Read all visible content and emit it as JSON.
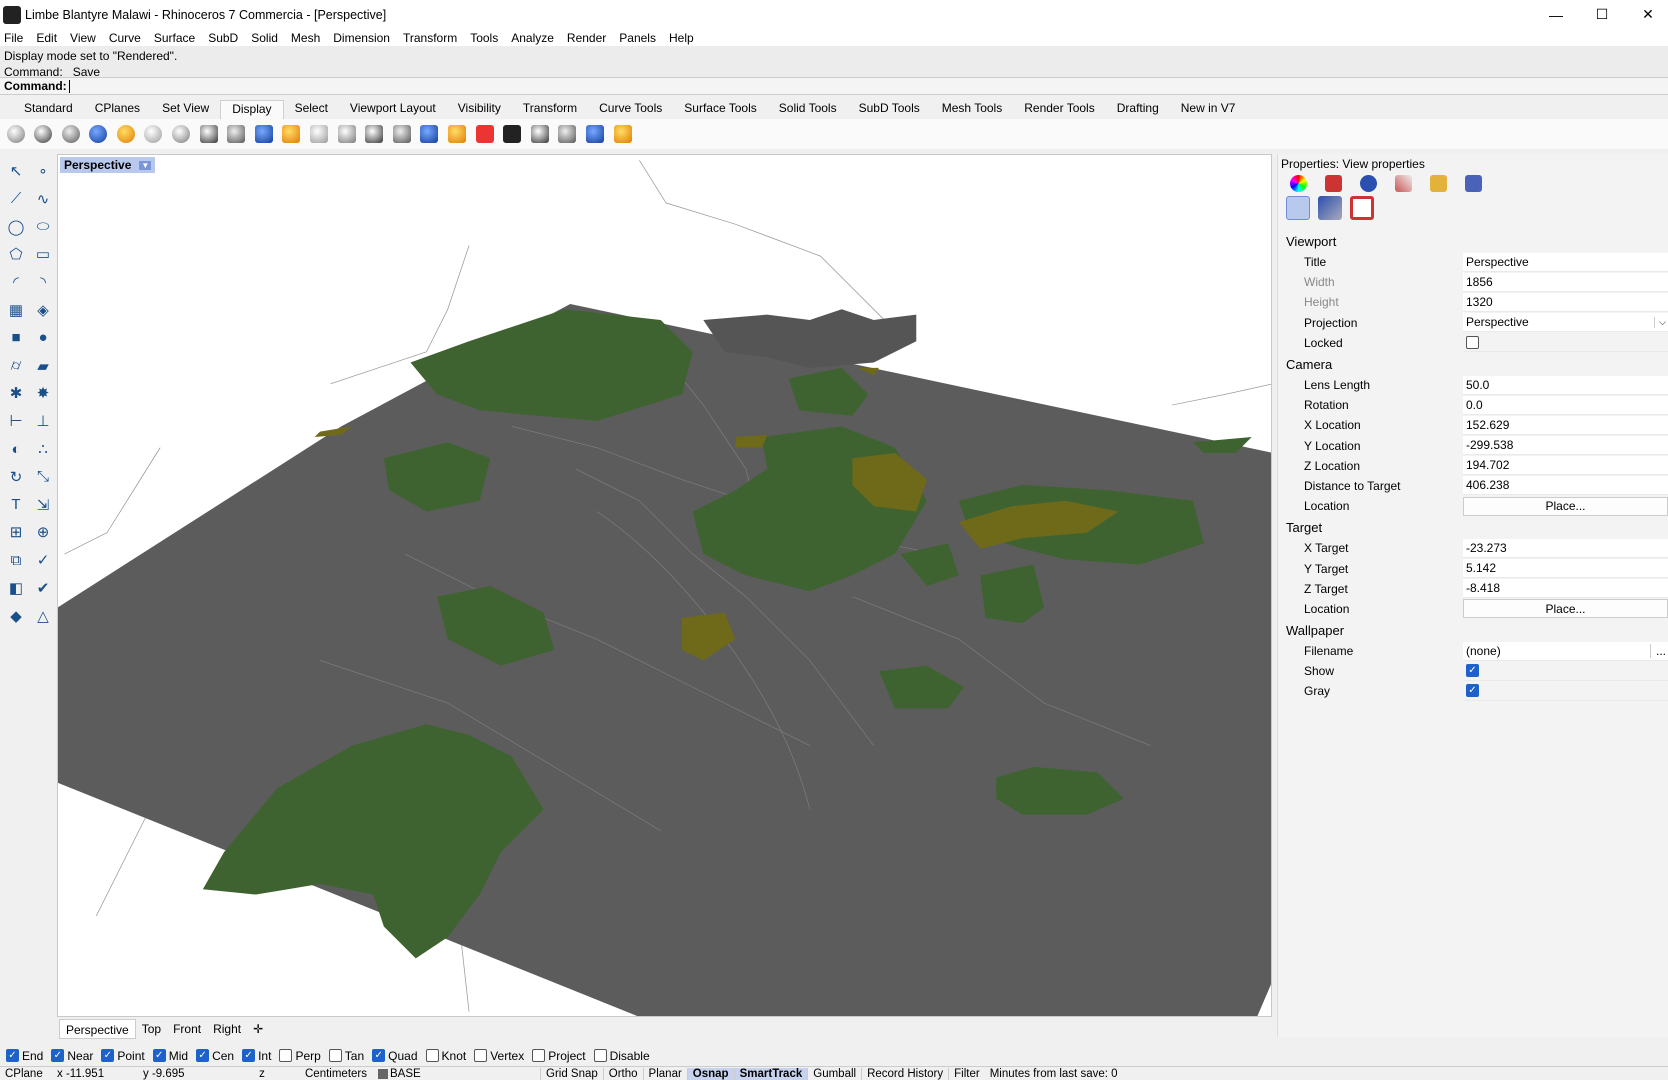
{
  "window": {
    "title": "Limbe Blantyre Malawi - Rhinoceros 7 Commercia - [Perspective]",
    "minimize": "—",
    "maximize": "☐",
    "close": "✕"
  },
  "menu": [
    "File",
    "Edit",
    "View",
    "Curve",
    "Surface",
    "SubD",
    "Solid",
    "Mesh",
    "Dimension",
    "Transform",
    "Tools",
    "Analyze",
    "Render",
    "Panels",
    "Help"
  ],
  "command": {
    "history": [
      "Display mode set to \"Rendered\".",
      "Command: _Save"
    ],
    "prompt": "Command:"
  },
  "toolbar_tabs": [
    "Standard",
    "CPlanes",
    "Set View",
    "Display",
    "Select",
    "Viewport Layout",
    "Visibility",
    "Transform",
    "Curve Tools",
    "Surface Tools",
    "Solid Tools",
    "SubD Tools",
    "Mesh Tools",
    "Render Tools",
    "Drafting",
    "New in V7"
  ],
  "active_tab": "Display",
  "toolbar_icons": [
    "wireframe",
    "shaded",
    "rendered",
    "ghosted",
    "xray",
    "technical",
    "artistic",
    "pen",
    "arctic",
    "monochrome",
    "hidden",
    "clipping-plane",
    "environment",
    "ground-plane",
    "lighting",
    "zebra",
    "curvature",
    "draft-angle",
    "show-object",
    "disable-viewport",
    "screen-capture",
    "section-tools",
    "display-options"
  ],
  "viewport": {
    "label": "Perspective",
    "colors": {
      "ground": "#5c5c5c",
      "forest": "#3f6330",
      "olive": "#6e6a1a"
    }
  },
  "viewport_tabs": [
    "Perspective",
    "Top",
    "Front",
    "Right",
    "✛"
  ],
  "properties": {
    "header": "Properties: View properties",
    "sections": [
      {
        "title": "Viewport",
        "rows": [
          {
            "key": "Title",
            "value": "Perspective"
          },
          {
            "key": "Width",
            "value": "1856",
            "dim": true
          },
          {
            "key": "Height",
            "value": "1320",
            "dim": true
          },
          {
            "key": "Projection",
            "value": "Perspective",
            "dropdown": true
          },
          {
            "key": "Locked",
            "check": false
          }
        ]
      },
      {
        "title": "Camera",
        "rows": [
          {
            "key": "Lens Length",
            "value": "50.0"
          },
          {
            "key": "Rotation",
            "value": "0.0"
          },
          {
            "key": "X Location",
            "value": "152.629"
          },
          {
            "key": "Y Location",
            "value": "-299.538"
          },
          {
            "key": "Z Location",
            "value": "194.702"
          },
          {
            "key": "Distance to Target",
            "value": "406.238"
          },
          {
            "key": "Location",
            "value": "Place...",
            "button": true
          }
        ]
      },
      {
        "title": "Target",
        "rows": [
          {
            "key": "X Target",
            "value": "-23.273"
          },
          {
            "key": "Y Target",
            "value": "5.142"
          },
          {
            "key": "Z Target",
            "value": "-8.418"
          },
          {
            "key": "Location",
            "value": "Place...",
            "button": true
          }
        ]
      },
      {
        "title": "Wallpaper",
        "rows": [
          {
            "key": "Filename",
            "value": "(none)",
            "ellipsis": "..."
          },
          {
            "key": "Show",
            "check": true
          },
          {
            "key": "Gray",
            "check": true
          }
        ]
      }
    ]
  },
  "osnaps": [
    {
      "label": "End",
      "on": true
    },
    {
      "label": "Near",
      "on": true
    },
    {
      "label": "Point",
      "on": true
    },
    {
      "label": "Mid",
      "on": true
    },
    {
      "label": "Cen",
      "on": true
    },
    {
      "label": "Int",
      "on": true
    },
    {
      "label": "Perp",
      "on": false
    },
    {
      "label": "Tan",
      "on": false
    },
    {
      "label": "Quad",
      "on": true
    },
    {
      "label": "Knot",
      "on": false
    },
    {
      "label": "Vertex",
      "on": false
    },
    {
      "label": "Project",
      "on": false
    },
    {
      "label": "Disable",
      "on": false
    }
  ],
  "status": {
    "cplane": "CPlane",
    "x": "x -11.951",
    "y": "y -9.695",
    "z": "z",
    "units": "Centimeters",
    "layer": "BASE",
    "toggles": [
      {
        "label": "Grid Snap",
        "on": false
      },
      {
        "label": "Ortho",
        "on": false
      },
      {
        "label": "Planar",
        "on": false
      },
      {
        "label": "Osnap",
        "on": true
      },
      {
        "label": "SmartTrack",
        "on": true
      },
      {
        "label": "Gumball",
        "on": false
      },
      {
        "label": "Record History",
        "on": false
      },
      {
        "label": "Filter",
        "on": false
      }
    ],
    "save_info": "Minutes from last save: 0"
  }
}
